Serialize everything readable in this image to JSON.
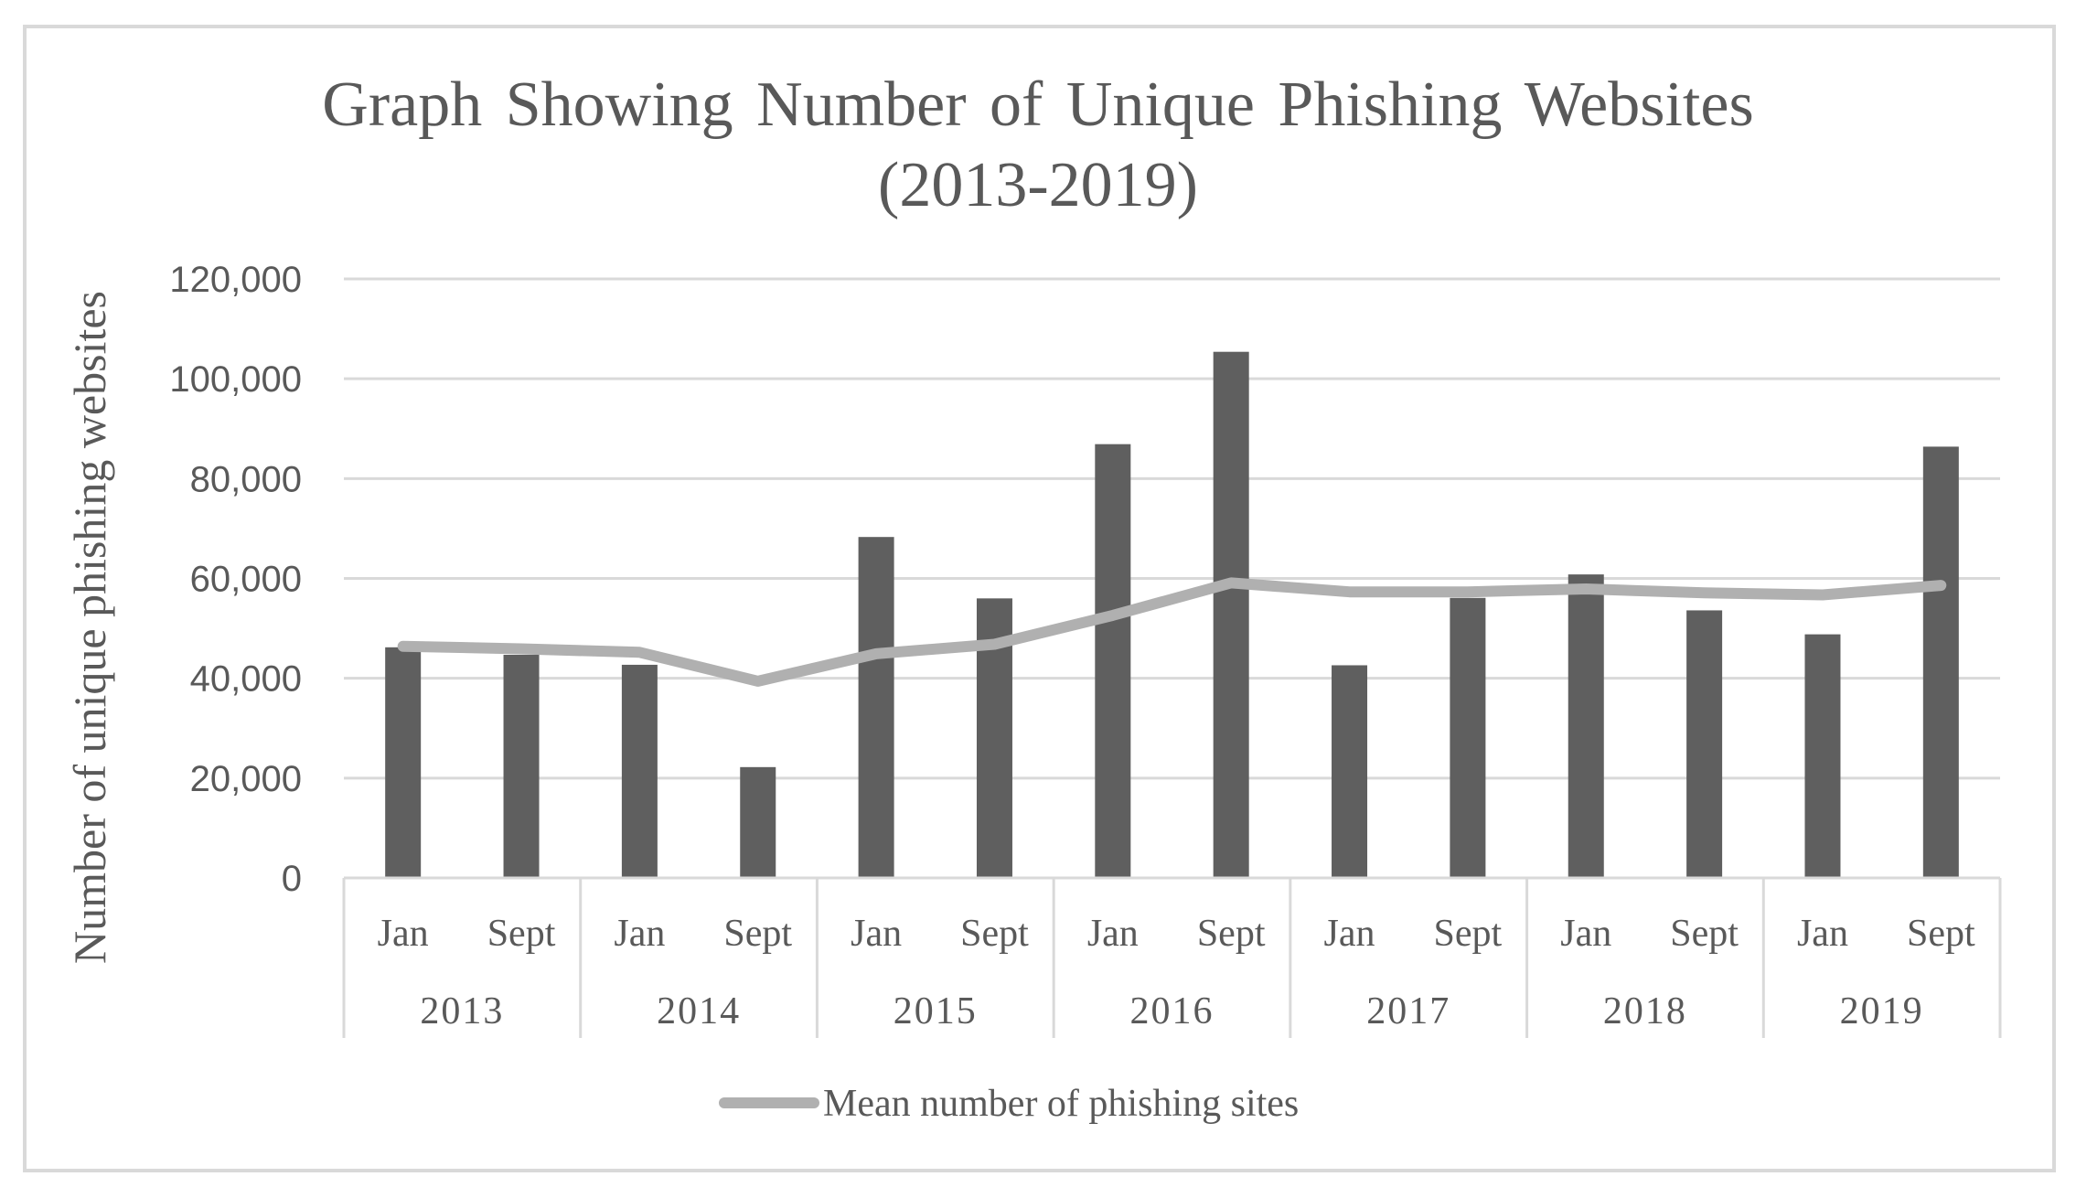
{
  "chart_data": {
    "type": "bar",
    "title": "Graph Showing Number of Unique Phishing Websites",
    "subtitle": "(2013-2019)",
    "xlabel": "",
    "ylabel": "Number of unique phishing websites",
    "ylim": [
      0,
      120000
    ],
    "yticks": [
      0,
      20000,
      40000,
      60000,
      80000,
      100000,
      120000
    ],
    "ytick_labels": [
      "0",
      "20,000",
      "40,000",
      "60,000",
      "80,000",
      "100,000",
      "120,000"
    ],
    "grid": true,
    "legend_position": "bottom",
    "groups": [
      {
        "year": "2013",
        "months": [
          "Jan",
          "Sept"
        ]
      },
      {
        "year": "2014",
        "months": [
          "Jan",
          "Sept"
        ]
      },
      {
        "year": "2015",
        "months": [
          "Jan",
          "Sept"
        ]
      },
      {
        "year": "2016",
        "months": [
          "Jan",
          "Sept"
        ]
      },
      {
        "year": "2017",
        "months": [
          "Jan",
          "Sept"
        ]
      },
      {
        "year": "2018",
        "months": [
          "Jan",
          "Sept"
        ]
      },
      {
        "year": "2019",
        "months": [
          "Jan",
          "Sept"
        ]
      }
    ],
    "categories": [
      "2013 Jan",
      "2013 Sept",
      "2014 Jan",
      "2014 Sept",
      "2015 Jan",
      "2015 Sept",
      "2016 Jan",
      "2016 Sept",
      "2017 Jan",
      "2017 Sept",
      "2018 Jan",
      "2018 Sept",
      "2019 Jan",
      "2019 Sept"
    ],
    "series": [
      {
        "name": "",
        "type": "bar",
        "in_legend": false,
        "color": "#5f5f5f",
        "values": [
          46200,
          44700,
          42700,
          22200,
          68300,
          56000,
          86900,
          105400,
          42600,
          56100,
          60800,
          53600,
          48800,
          86400
        ]
      },
      {
        "name": "Mean number of phishing sites",
        "type": "line",
        "in_legend": true,
        "color": "#b0b0b0",
        "values": [
          46400,
          45900,
          45200,
          39400,
          44900,
          46800,
          52600,
          59100,
          57300,
          57300,
          57900,
          57100,
          56700,
          58600
        ]
      }
    ]
  },
  "colors": {
    "bar": "#5f5f5f",
    "line": "#b0b0b0",
    "grid": "#d9d9d9",
    "text": "#595959",
    "frame": "#d9d9d9"
  }
}
